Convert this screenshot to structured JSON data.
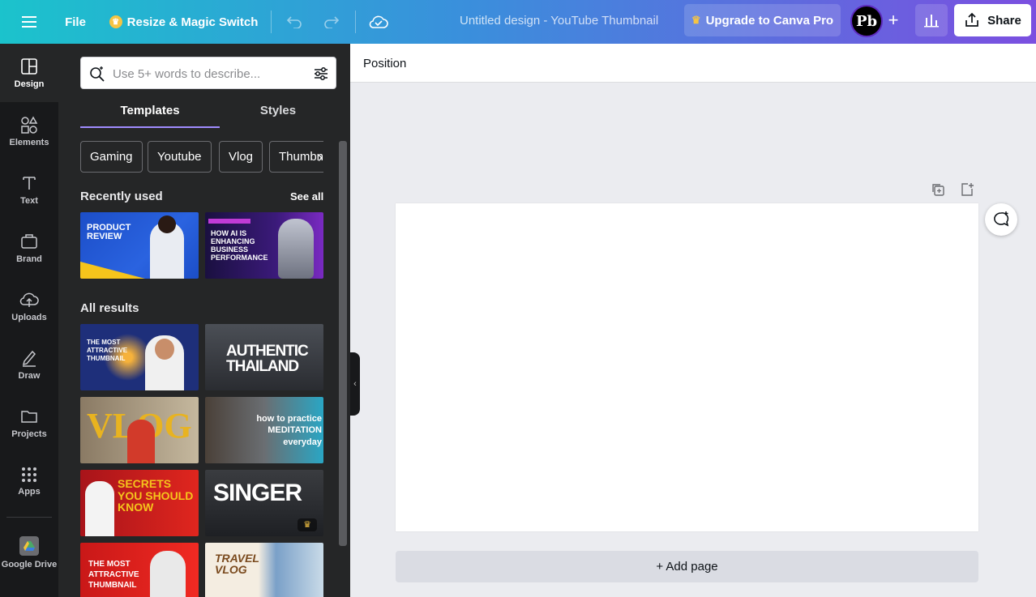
{
  "topbar": {
    "file_label": "File",
    "resize_label": "Resize & Magic Switch",
    "title": "Untitled design - YouTube Thumbnail",
    "upgrade_label": "Upgrade to Canva Pro",
    "avatar_initials": "Pb",
    "share_label": "Share"
  },
  "rail": {
    "items": [
      {
        "label": "Design",
        "icon": "layout-icon"
      },
      {
        "label": "Elements",
        "icon": "shapes-icon"
      },
      {
        "label": "Text",
        "icon": "text-icon"
      },
      {
        "label": "Brand",
        "icon": "brand-icon"
      },
      {
        "label": "Uploads",
        "icon": "cloud-upload-icon"
      },
      {
        "label": "Draw",
        "icon": "pen-icon"
      },
      {
        "label": "Projects",
        "icon": "folder-icon"
      },
      {
        "label": "Apps",
        "icon": "apps-grid-icon"
      },
      {
        "label": "Google Drive",
        "icon": "google-drive-icon"
      }
    ]
  },
  "panel": {
    "search_placeholder": "Use 5+ words to describe...",
    "tabs": [
      "Templates",
      "Styles"
    ],
    "chips": [
      "Gaming",
      "Youtube",
      "Vlog",
      "Thumbn"
    ],
    "recently_used_heading": "Recently used",
    "see_all": "See all",
    "all_results_heading": "All results",
    "recent": [
      {
        "text": "PRODUCT REVIEW"
      },
      {
        "text": "HOW AI IS ENHANCING BUSINESS PERFORMANCE"
      }
    ],
    "results": [
      {
        "text": "THE MOST ATTRACTIVE THUMBNAIL"
      },
      {
        "text": "AUTHENTIC THAILAND"
      },
      {
        "text": "VLOG"
      },
      {
        "text": "how to practice MEDITATION everyday"
      },
      {
        "text": "SECRETS YOU SHOULD KNOW"
      },
      {
        "text": "SINGER"
      },
      {
        "text": "THE MOST ATTRACTIVE THUMBNAIL"
      },
      {
        "text": "TRAVEL VLOG"
      }
    ]
  },
  "canvas": {
    "context_label": "Position",
    "add_page_label": "+ Add page"
  },
  "colors": {
    "topbar_start": "#1bc3cc",
    "topbar_end": "#7b4fe0",
    "tab_accent": "#9f8bff",
    "panel_bg": "#252627",
    "rail_bg": "#18191b"
  }
}
